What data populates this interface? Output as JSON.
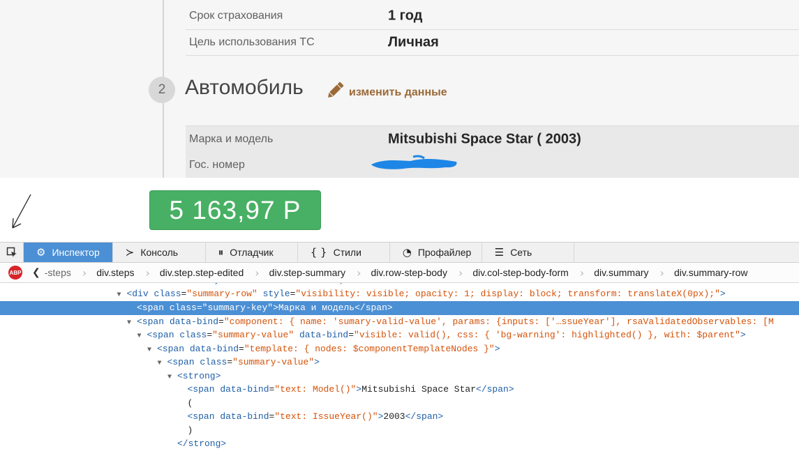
{
  "page": {
    "summary_rows_top": [
      {
        "key": "Срок страхования",
        "value": "1 год"
      },
      {
        "key": "Цель использования ТС",
        "value": "Личная"
      }
    ],
    "step": {
      "number": "2",
      "title": "Автомобиль",
      "edit_label": "изменить данные"
    },
    "summary_rows_car": [
      {
        "key": "Марка и модель",
        "value": "Mitsubishi Space Star ( 2003)"
      },
      {
        "key": "Гос. номер",
        "value": ""
      }
    ],
    "price": "5 163,97 Р"
  },
  "devtools": {
    "tabs": [
      {
        "label": "Инспектор",
        "icon": "inspector-icon",
        "active": true
      },
      {
        "label": "Консоль",
        "icon": "console-icon"
      },
      {
        "label": "Отладчик",
        "icon": "debugger-icon"
      },
      {
        "label": "Стили",
        "icon": "braces-icon"
      },
      {
        "label": "Профайлер",
        "icon": "profiler-icon"
      },
      {
        "label": "Сеть",
        "icon": "network-icon"
      }
    ],
    "abp_label": "ABP",
    "breadcrumbs": [
      "-steps",
      "div.steps",
      "div.step.step-edited",
      "div.step-summary",
      "div.row-step-body",
      "div.col-step-body-form",
      "div.summary",
      "div.summary-row"
    ],
    "markup": [
      {
        "indent": 0,
        "tri": "",
        "html": "<div class=\"summary\" data-bind=\"with: Steps\">",
        "partial": true
      },
      {
        "indent": 1,
        "tri": "▼",
        "parts": [
          [
            "tg",
            "<div "
          ],
          [
            "an",
            "class"
          ],
          [
            "p",
            "="
          ],
          [
            "av",
            "\"summary-row\""
          ],
          [
            "p",
            " "
          ],
          [
            "an",
            "style"
          ],
          [
            "p",
            "="
          ],
          [
            "av",
            "\"visibility: visible; opacity: 1; display: block; transform: translateX(0px);\""
          ],
          [
            "tg",
            ">"
          ]
        ]
      },
      {
        "indent": 2,
        "tri": "",
        "selected": true,
        "parts": [
          [
            "tg",
            "<span "
          ],
          [
            "an",
            "class"
          ],
          [
            "p",
            "="
          ],
          [
            "av",
            "\"summary-key\""
          ],
          [
            "tg",
            ">"
          ],
          [
            "p",
            "Марка и модель"
          ],
          [
            "tg",
            "</span>"
          ]
        ]
      },
      {
        "indent": 2,
        "tri": "▼",
        "parts": [
          [
            "tg",
            "<span "
          ],
          [
            "an",
            "data-bind"
          ],
          [
            "p",
            "="
          ],
          [
            "av",
            "\"component: { name: 'sumary-valid-value', params: {inputs: ['…ssueYear'], rsaValidatedObservables: [M"
          ]
        ]
      },
      {
        "indent": 3,
        "tri": "▼",
        "parts": [
          [
            "tg",
            "<span "
          ],
          [
            "an",
            "class"
          ],
          [
            "p",
            "="
          ],
          [
            "av",
            "\"summary-value\""
          ],
          [
            "p",
            " "
          ],
          [
            "an",
            "data-bind"
          ],
          [
            "p",
            "="
          ],
          [
            "av",
            "\"visible: valid(), css: { 'bg-warning': highlighted() }, with: $parent\""
          ],
          [
            "tg",
            ">"
          ]
        ]
      },
      {
        "indent": 4,
        "tri": "▼",
        "parts": [
          [
            "tg",
            "<span "
          ],
          [
            "an",
            "data-bind"
          ],
          [
            "p",
            "="
          ],
          [
            "av",
            "\"template: { nodes: $componentTemplateNodes }\""
          ],
          [
            "tg",
            ">"
          ]
        ]
      },
      {
        "indent": 5,
        "tri": "▼",
        "parts": [
          [
            "tg",
            "<span "
          ],
          [
            "an",
            "class"
          ],
          [
            "p",
            "="
          ],
          [
            "av",
            "\"summary-value\""
          ],
          [
            "tg",
            ">"
          ]
        ]
      },
      {
        "indent": 6,
        "tri": "▼",
        "parts": [
          [
            "tg",
            "<strong>"
          ]
        ]
      },
      {
        "indent": 7,
        "tri": "",
        "parts": [
          [
            "tg",
            "<span "
          ],
          [
            "an",
            "data-bind"
          ],
          [
            "p",
            "="
          ],
          [
            "av",
            "\"text: Model()\""
          ],
          [
            "tg",
            ">"
          ],
          [
            "p",
            "Mitsubishi Space Star"
          ],
          [
            "tg",
            "</span>"
          ]
        ]
      },
      {
        "indent": 7,
        "tri": "",
        "parts": [
          [
            "p",
            "("
          ]
        ]
      },
      {
        "indent": 7,
        "tri": "",
        "parts": [
          [
            "tg",
            "<span "
          ],
          [
            "an",
            "data-bind"
          ],
          [
            "p",
            "="
          ],
          [
            "av",
            "\"text: IssueYear()\""
          ],
          [
            "tg",
            ">"
          ],
          [
            "p",
            "2003"
          ],
          [
            "tg",
            "</span>"
          ]
        ]
      },
      {
        "indent": 7,
        "tri": "",
        "parts": [
          [
            "p",
            ")"
          ]
        ]
      },
      {
        "indent": 6,
        "tri": "",
        "parts": [
          [
            "tg",
            "</strong>"
          ]
        ]
      }
    ]
  }
}
